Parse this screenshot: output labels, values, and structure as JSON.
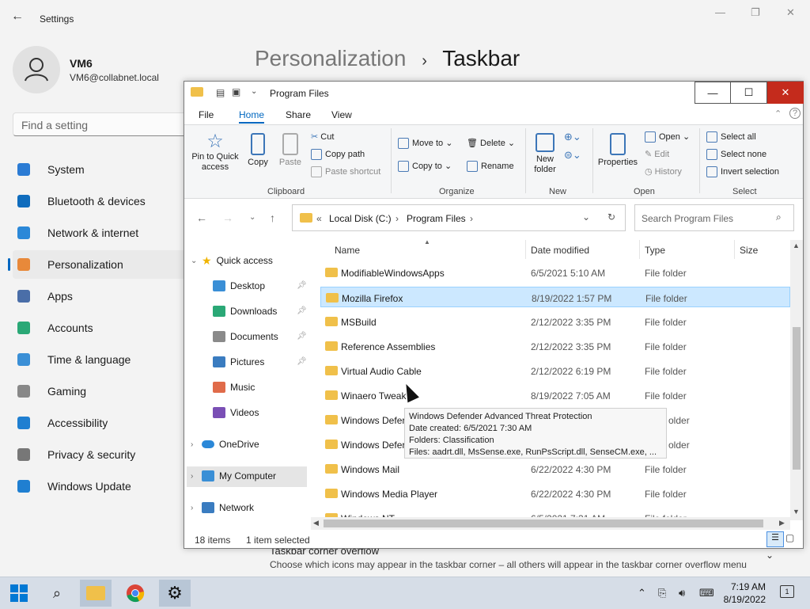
{
  "settings": {
    "title": "Settings",
    "user": {
      "name": "VM6",
      "email": "VM6@collabnet.local"
    },
    "search_placeholder": "Find a setting",
    "nav": [
      {
        "label": "System",
        "icon": "monitor-icon",
        "color": "#2b7bd4"
      },
      {
        "label": "Bluetooth & devices",
        "icon": "bluetooth-icon",
        "color": "#0f6cbd"
      },
      {
        "label": "Network & internet",
        "icon": "wifi-icon",
        "color": "#2b88d8"
      },
      {
        "label": "Personalization",
        "icon": "brush-icon",
        "color": "#e8893a"
      },
      {
        "label": "Apps",
        "icon": "apps-icon",
        "color": "#4a6ea8"
      },
      {
        "label": "Accounts",
        "icon": "person-icon",
        "color": "#2aa876"
      },
      {
        "label": "Time & language",
        "icon": "clock-globe-icon",
        "color": "#3a8fd6"
      },
      {
        "label": "Gaming",
        "icon": "gamepad-icon",
        "color": "#888888"
      },
      {
        "label": "Accessibility",
        "icon": "accessibility-icon",
        "color": "#1f7fd1"
      },
      {
        "label": "Privacy & security",
        "icon": "shield-icon",
        "color": "#777777"
      },
      {
        "label": "Windows Update",
        "icon": "update-icon",
        "color": "#1f7fd1"
      }
    ],
    "active_nav": "Personalization",
    "breadcrumb": {
      "parent": "Personalization",
      "sep": "›",
      "current": "Taskbar"
    },
    "overflow": {
      "title": "Taskbar corner overflow",
      "desc": "Choose which icons may appear in the taskbar corner – all others will appear in the taskbar corner overflow menu"
    }
  },
  "explorer": {
    "title": "Program Files",
    "controls": {
      "minimize": "—",
      "maximize": "☐",
      "close": "✕"
    },
    "tabs": [
      "File",
      "Home",
      "Share",
      "View"
    ],
    "active_tab": "Home",
    "ribbon": {
      "clipboard": {
        "group": "Clipboard",
        "pin": "Pin to Quick access",
        "copy": "Copy",
        "paste": "Paste",
        "cut": "Cut",
        "copy_path": "Copy path",
        "paste_shortcut": "Paste shortcut"
      },
      "organize": {
        "group": "Organize",
        "move_to": "Move to",
        "copy_to": "Copy to",
        "delete": "Delete",
        "rename": "Rename"
      },
      "new": {
        "group": "New",
        "new_folder": "New folder"
      },
      "open": {
        "group": "Open",
        "properties": "Properties",
        "open": "Open",
        "edit": "Edit",
        "history": "History"
      },
      "select": {
        "group": "Select",
        "select_all": "Select all",
        "select_none": "Select none",
        "invert": "Invert selection"
      }
    },
    "address": {
      "prefix": "«",
      "parts": [
        "Local Disk (C:)",
        "Program Files"
      ],
      "sep": "›"
    },
    "search_placeholder": "Search Program Files",
    "tree": {
      "quick_access": "Quick access",
      "items": [
        {
          "label": "Desktop",
          "pinned": true,
          "color": "#3a8fd6"
        },
        {
          "label": "Downloads",
          "pinned": true,
          "color": "#2aa876"
        },
        {
          "label": "Documents",
          "pinned": true,
          "color": "#8a8a8a"
        },
        {
          "label": "Pictures",
          "pinned": true,
          "color": "#3a7cc0"
        },
        {
          "label": "Music",
          "pinned": false,
          "color": "#e06b4a"
        },
        {
          "label": "Videos",
          "pinned": false,
          "color": "#7a4fb5"
        }
      ],
      "onedrive": "OneDrive",
      "my_computer": "My Computer",
      "network": "Network"
    },
    "columns": {
      "name": "Name",
      "date": "Date modified",
      "type": "Type",
      "size": "Size"
    },
    "files": [
      {
        "name": "ModifiableWindowsApps",
        "date": "6/5/2021 5:10 AM",
        "type": "File folder"
      },
      {
        "name": "Mozilla Firefox",
        "date": "8/19/2022 1:57 PM",
        "type": "File folder",
        "selected": true
      },
      {
        "name": "MSBuild",
        "date": "2/12/2022 3:35 PM",
        "type": "File folder"
      },
      {
        "name": "Reference Assemblies",
        "date": "2/12/2022 3:35 PM",
        "type": "File folder"
      },
      {
        "name": "Virtual Audio Cable",
        "date": "2/12/2022 6:19 PM",
        "type": "File folder"
      },
      {
        "name": "Winaero Tweak",
        "date": "8/19/2022 7:05 AM",
        "type": "File folder"
      },
      {
        "name": "Windows Defer",
        "date": "",
        "type": "older"
      },
      {
        "name": "Windows Defer",
        "date": "",
        "type": "older"
      },
      {
        "name": "Windows Mail",
        "date": "6/22/2022 4:30 PM",
        "type": "File folder"
      },
      {
        "name": "Windows Media Player",
        "date": "6/22/2022 4:30 PM",
        "type": "File folder"
      },
      {
        "name": "Windows NT",
        "date": "6/5/2021 7:31 AM",
        "type": "File folder"
      }
    ],
    "tooltip": {
      "line1": "Windows Defender Advanced Threat Protection",
      "line2": "Date created: 6/5/2021 7:30 AM",
      "line3": "Folders: Classification",
      "line4": "Files: aadrt.dll, MsSense.exe, RunPsScript.dll, SenseCM.exe, ..."
    },
    "status": {
      "count": "18 items",
      "selected": "1 item selected"
    }
  },
  "taskbar": {
    "time": "7:19 AM",
    "date": "8/19/2022",
    "notifications": "1",
    "tray_icons": [
      "chevron-up-icon",
      "network-icon",
      "volume-icon"
    ]
  }
}
